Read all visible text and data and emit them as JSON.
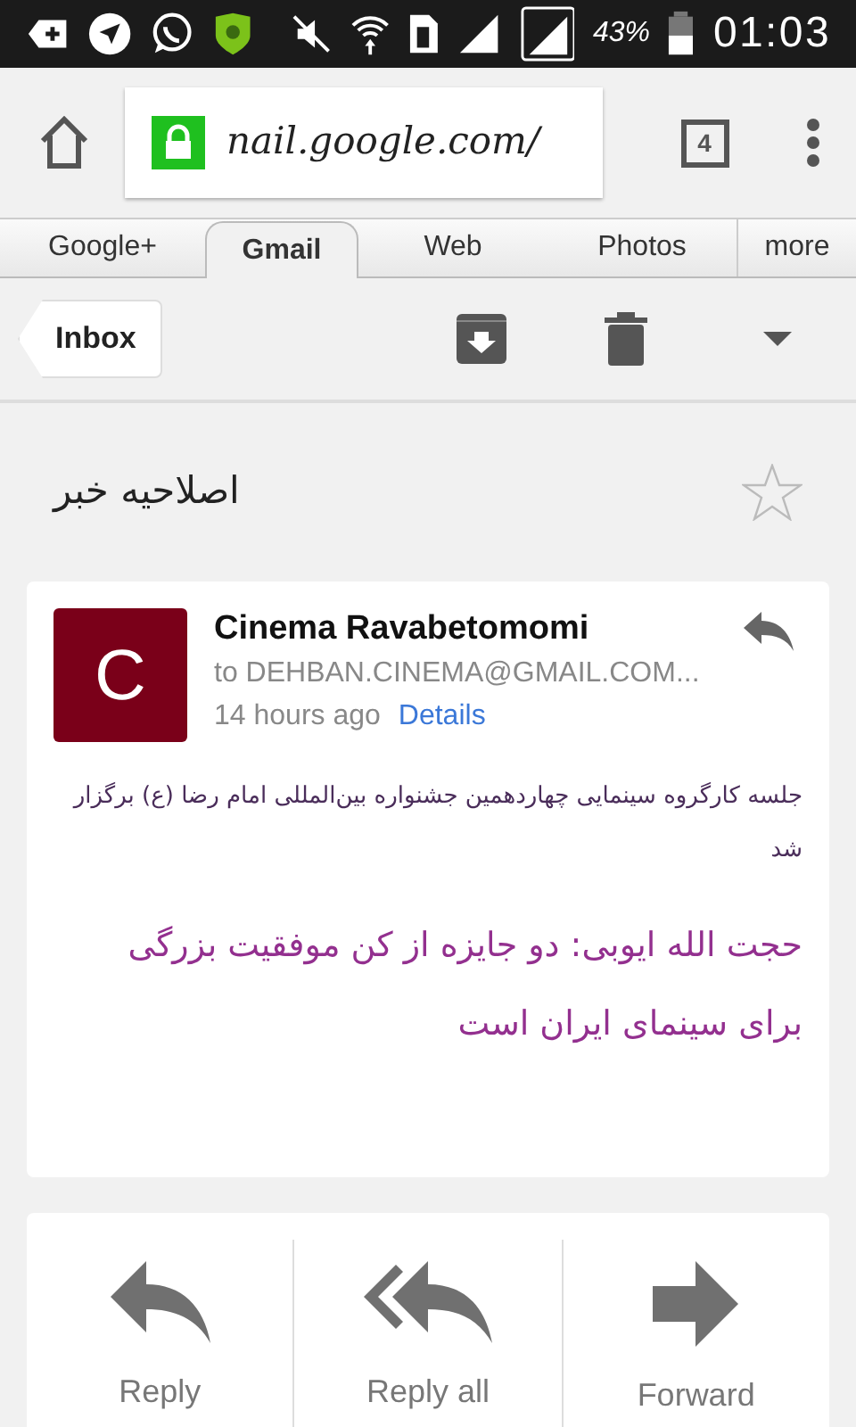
{
  "status_bar": {
    "battery": "43%",
    "time": "01:03"
  },
  "browser": {
    "url": "nail.google.com/",
    "tab_count": "4"
  },
  "nav_tabs": [
    {
      "label": "Google+",
      "selected": false
    },
    {
      "label": "Gmail",
      "selected": true
    },
    {
      "label": "Web",
      "selected": false
    },
    {
      "label": "Photos",
      "selected": false
    },
    {
      "label": "more",
      "selected": false
    }
  ],
  "toolbar": {
    "back_label": "Inbox"
  },
  "subject": {
    "text": "اصلاحیه خبر",
    "starred": false
  },
  "message": {
    "avatar_letter": "C",
    "sender": "Cinema Ravabetomomi",
    "recipient": "to DEHBAN.CINEMA@GMAIL.COM...",
    "time": "14 hours ago",
    "details_link": "Details",
    "lead": "جلسه کارگروه سینمایی چهاردهمین جشنواره بین‌المللی امام رضا (ع) برگزار شد",
    "headline": "حجت الله ایوبی: دو جایزه از کن موفقیت بزرگی برای سینمای ایران است"
  },
  "actions": [
    {
      "label": "Reply",
      "kind": "reply"
    },
    {
      "label": "Reply all",
      "kind": "reply_all"
    },
    {
      "label": "Forward",
      "kind": "forward"
    }
  ]
}
